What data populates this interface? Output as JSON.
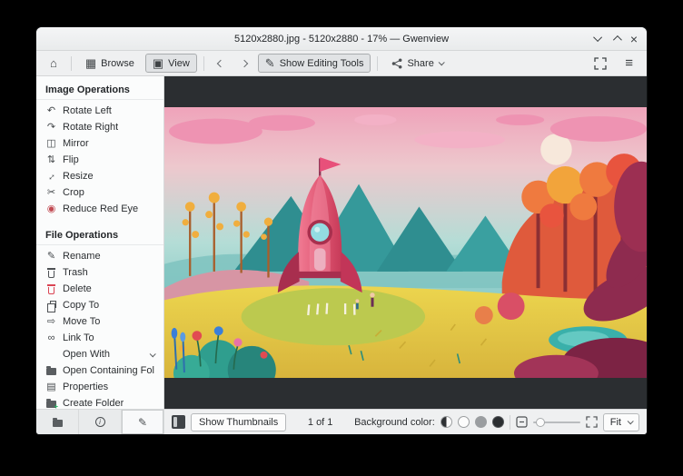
{
  "window": {
    "title": "5120x2880.jpg - 5120x2880 - 17% — Gwenview"
  },
  "toolbar": {
    "browse_label": "Browse",
    "view_label": "View",
    "show_editing_tools_label": "Show Editing Tools",
    "share_label": "Share"
  },
  "icons": {
    "home": "⌂",
    "browse_grid": "▦",
    "view_image": "▣",
    "pencil": "✎",
    "menu": "≡",
    "close": "×",
    "rotate_left": "↶",
    "rotate_right": "↷",
    "mirror": "◫",
    "flip": "⇅",
    "resize": "↔",
    "crop": "✂",
    "red_eye": "◉",
    "rename": "✎",
    "move_to": "⇨",
    "link_to": "∞",
    "properties": "▤",
    "info": "i",
    "plus": "+"
  },
  "sidebar": {
    "sections": [
      {
        "title": "Image Operations",
        "items": [
          {
            "label": "Rotate Left"
          },
          {
            "label": "Rotate Right"
          },
          {
            "label": "Mirror"
          },
          {
            "label": "Flip"
          },
          {
            "label": "Resize"
          },
          {
            "label": "Crop"
          },
          {
            "label": "Reduce Red Eye"
          }
        ]
      },
      {
        "title": "File Operations",
        "items": [
          {
            "label": "Rename"
          },
          {
            "label": "Trash"
          },
          {
            "label": "Delete"
          },
          {
            "label": "Copy To"
          },
          {
            "label": "Move To"
          },
          {
            "label": "Link To"
          },
          {
            "label": "Open With"
          },
          {
            "label": "Open Containing Folder"
          },
          {
            "label": "Properties"
          },
          {
            "label": "Create Folder"
          }
        ]
      }
    ]
  },
  "statusbar": {
    "show_thumbnails_label": "Show Thumbnails",
    "counter": "1 of 1",
    "background_color_label": "Background color:",
    "zoom_mode": "Fit"
  },
  "colors": {
    "accent": "#3daee9",
    "chrome": "#eff0f1",
    "canvas": "#2b2e31"
  }
}
